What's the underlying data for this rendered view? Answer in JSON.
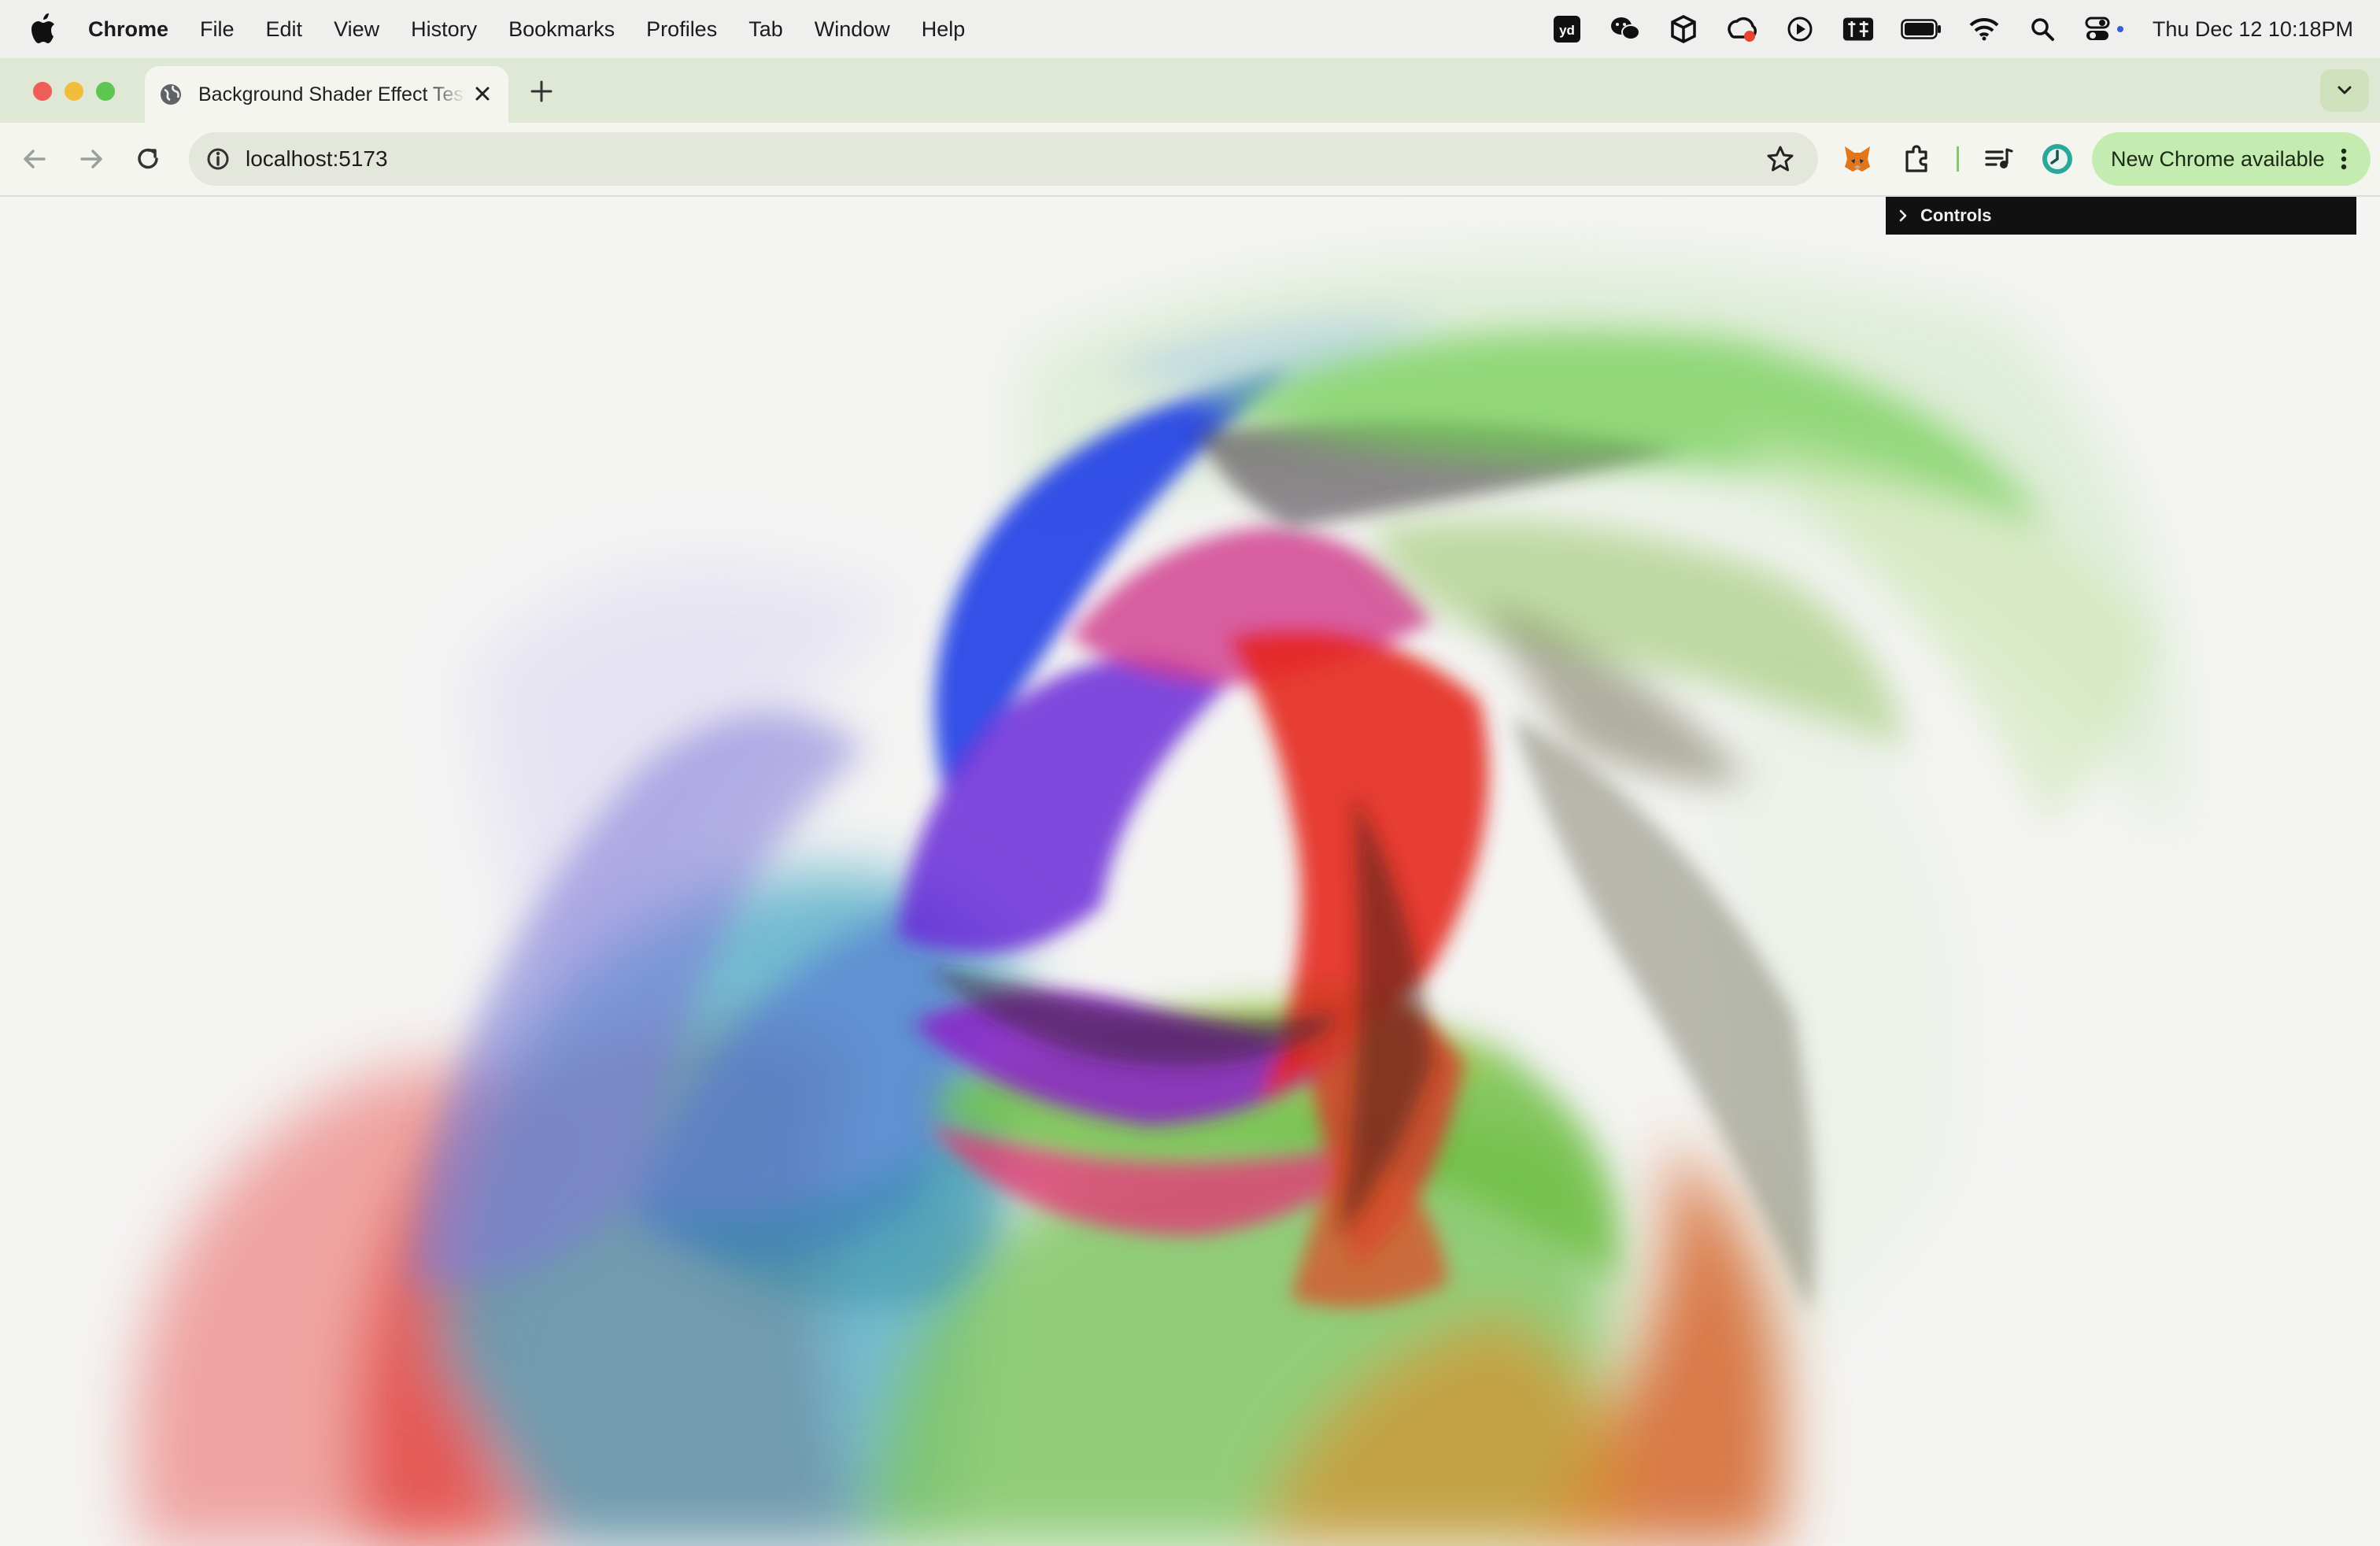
{
  "menubar": {
    "app_name": "Chrome",
    "items": [
      "File",
      "Edit",
      "View",
      "History",
      "Bookmarks",
      "Profiles",
      "Tab",
      "Window",
      "Help"
    ],
    "clock": "Thu Dec 12  10:18PM",
    "status_icons": [
      "youdao-icon",
      "wechat-icon",
      "package-icon",
      "cloud-sync-icon",
      "play-circle-icon",
      "input-method-icon",
      "battery-icon",
      "wifi-icon",
      "spotlight-search-icon",
      "control-center-icon"
    ]
  },
  "browser": {
    "tab": {
      "title": "Background Shader Effect Test"
    },
    "address": "localhost:5173",
    "update_label": "New Chrome available"
  },
  "page": {
    "controls_label": "Controls",
    "canvas": "swirling multicolor shader render"
  },
  "colors": {
    "tabstrip_bg": "#dfe8d4",
    "toolbar_bg": "#f4f5ef",
    "update_pill": "#c4ecb0",
    "controls_bg": "#111111",
    "page_bg": "#f4f4f3"
  }
}
